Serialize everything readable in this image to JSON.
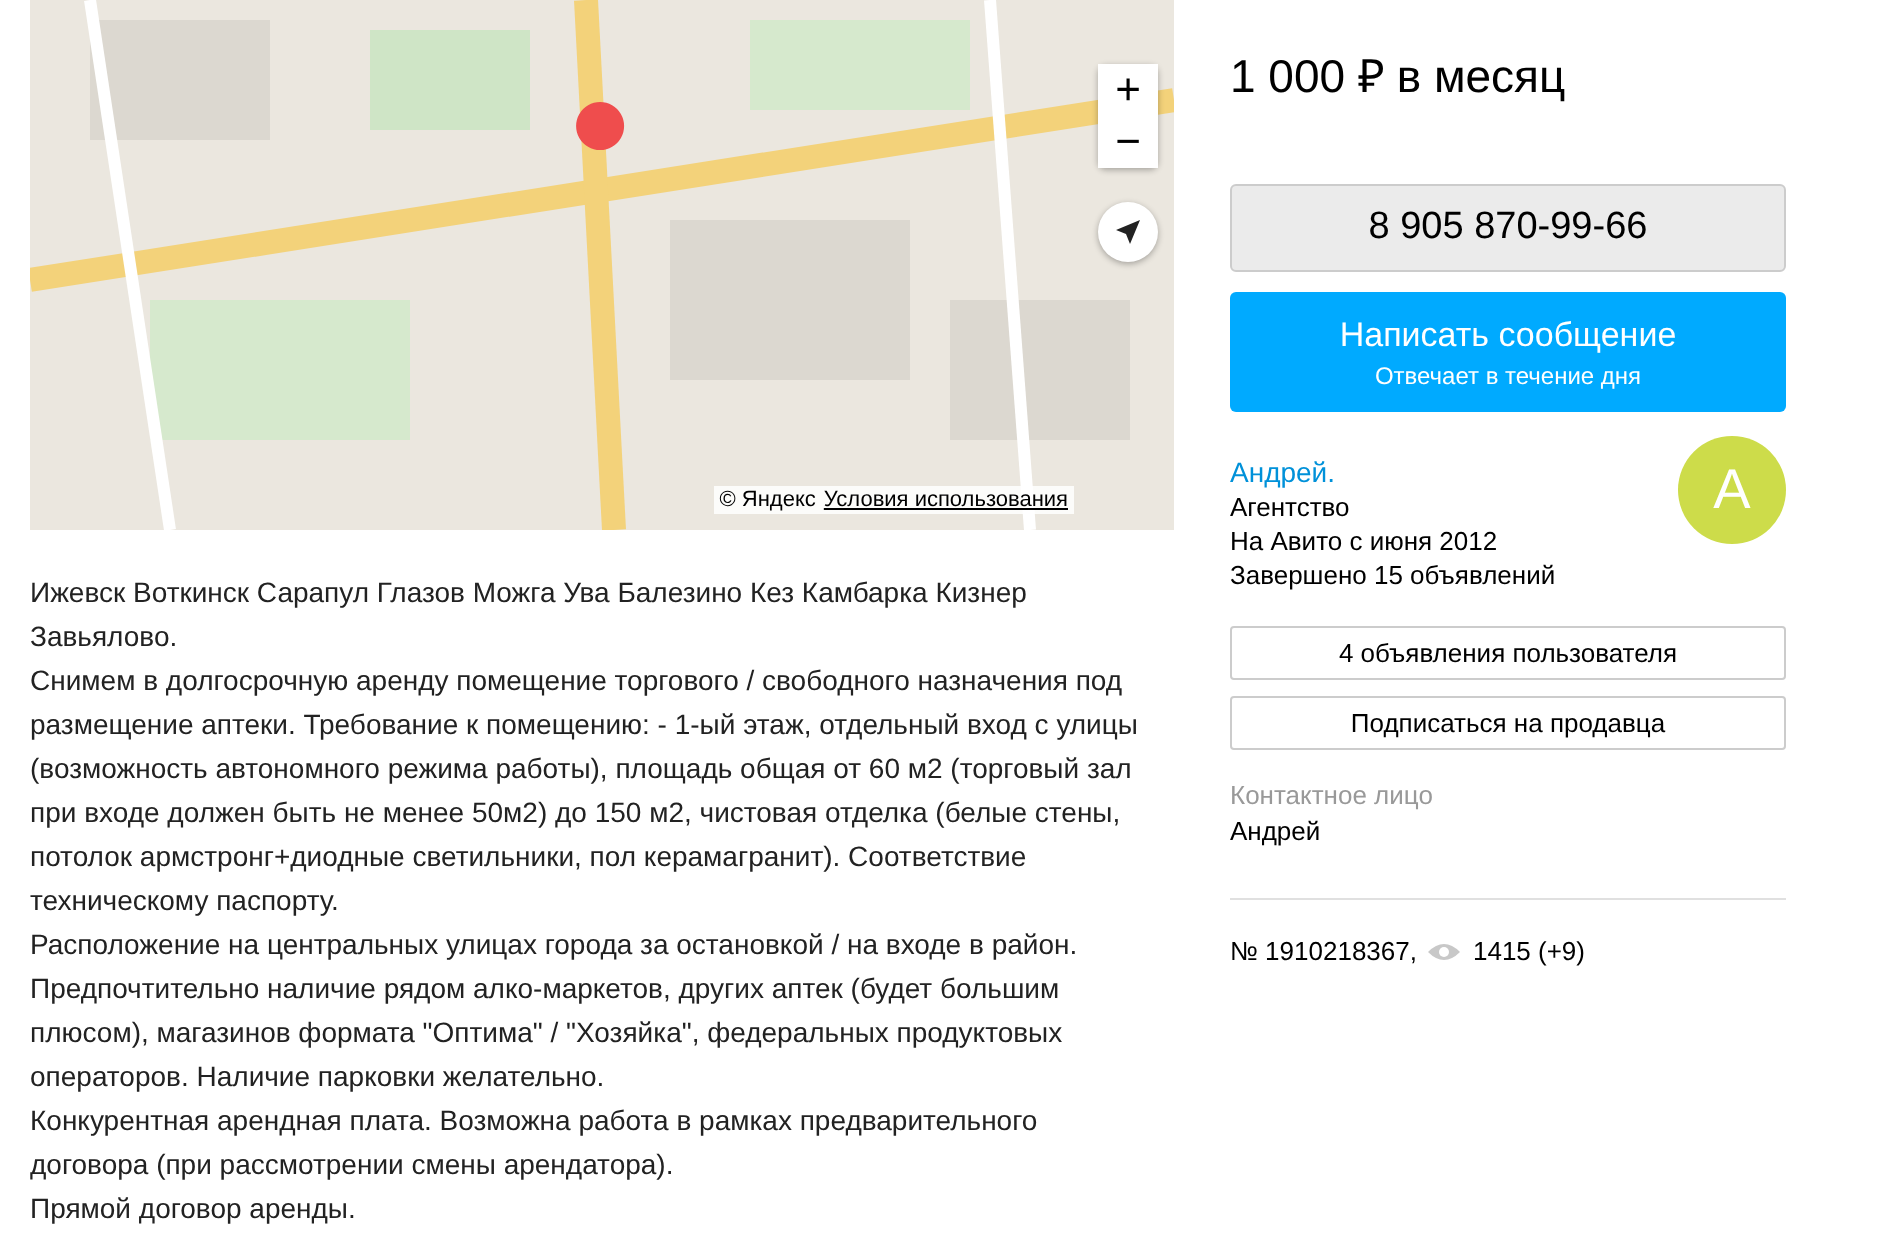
{
  "map": {
    "kind": "picture",
    "zoom_in": "+",
    "zoom_out": "−",
    "attribution": "© Яндекс",
    "terms_link": "Условия использования"
  },
  "description": [
    "Ижевск Воткинск Сарапул Глазов Можга Ува Балезино Кез Камбарка Кизнер Завьялово.",
    "Снимем в долгосрочную аренду помещение торгового / свободного назначения под размещение аптеки. Требование к помещению: - 1-ый этаж, отдельный вход с улицы (возможность автономного режима работы), площадь общая от 60 м2 (торговый зал при входе должен быть не менее 50м2) до 150 м2, чистовая отделка (белые стены, потолок армстронг+диодные светильники, пол керамагранит). Соответствие техническому паспорту.",
    "Расположение на центральных улицах города за остановкой / на входе в район.",
    "Предпочтительно наличие рядом алко-маркетов, других аптек (будет большим плюсом), магазинов формата \"Оптима\" / \"Хозяйка\", федеральных продуктовых операторов. Наличие парковки желательно.",
    "Конкурентная арендная плата. Возможна работа в рамках предварительного договора (при рассмотрении смены арендатора).",
    "Прямой договор аренды."
  ],
  "price": "1 000 ₽ в месяц",
  "phone_button": "8 905 870-99-66",
  "message_button": {
    "label": "Написать сообщение",
    "note": "Отвечает в течение дня"
  },
  "seller": {
    "name": "Андрей.",
    "type": "Агентство",
    "since": "На Авито с июня 2012",
    "completed": "Завершено 15 объявлений",
    "avatar_letter": "А"
  },
  "seller_buttons": [
    "4 объявления пользователя",
    "Подписаться на продавца"
  ],
  "contact": {
    "label": "Контактное лицо",
    "name": "Андрей"
  },
  "listing": {
    "number": "№ 1910218367,",
    "views": "1415 (+9)"
  }
}
